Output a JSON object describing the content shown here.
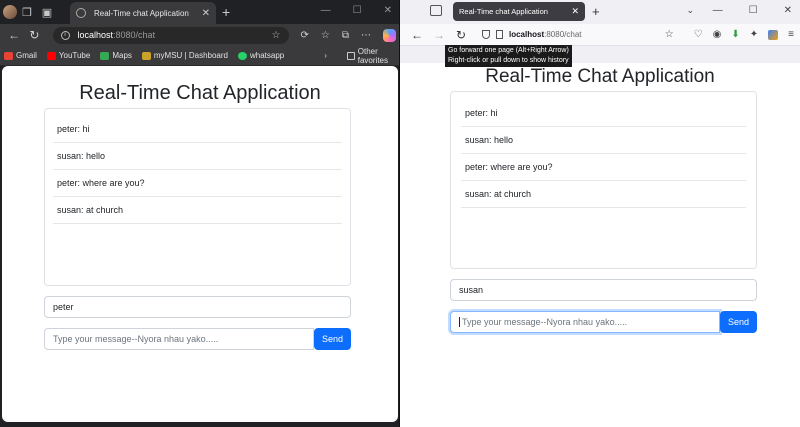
{
  "left_window": {
    "tab": {
      "title": "Real-Time chat Application"
    },
    "address": {
      "host": "localhost",
      "path": ":8080/chat"
    },
    "bookmarks": [
      {
        "label": "Gmail",
        "color": "#ea4335"
      },
      {
        "label": "YouTube",
        "color": "#ff0000"
      },
      {
        "label": "Maps",
        "color": "#34a853"
      },
      {
        "label": "myMSU | Dashboard",
        "color": "#c9a227"
      },
      {
        "label": "whatsapp",
        "color": "#25d366"
      }
    ],
    "other_favorites": "Other favorites",
    "app": {
      "title": "Real-Time Chat Application",
      "messages": [
        "peter: hi",
        "susan: hello",
        "peter: where are you?",
        "susan: at church"
      ],
      "username": "peter",
      "message_placeholder": "Type your message--Nyora nhau yako.....",
      "send_label": "Send"
    }
  },
  "right_window": {
    "tab": {
      "title": "Real-Time chat Application"
    },
    "address": {
      "host": "localhost",
      "path": ":8080/chat"
    },
    "tooltip": {
      "line1": "Go forward one page (Alt+Right Arrow)",
      "line2": "Right-click or pull down to show history"
    },
    "app": {
      "title": "Real-Time Chat Application",
      "messages": [
        "peter: hi",
        "susan: hello",
        "peter: where are you?",
        "susan: at church"
      ],
      "username": "susan",
      "message_placeholder": "Type your message--Nyora nhau yako.....",
      "send_label": "Send"
    }
  },
  "colors": {
    "primary": "#0d6efd",
    "edge_dark": "#202124",
    "firefox_light": "#f0f0f4"
  }
}
